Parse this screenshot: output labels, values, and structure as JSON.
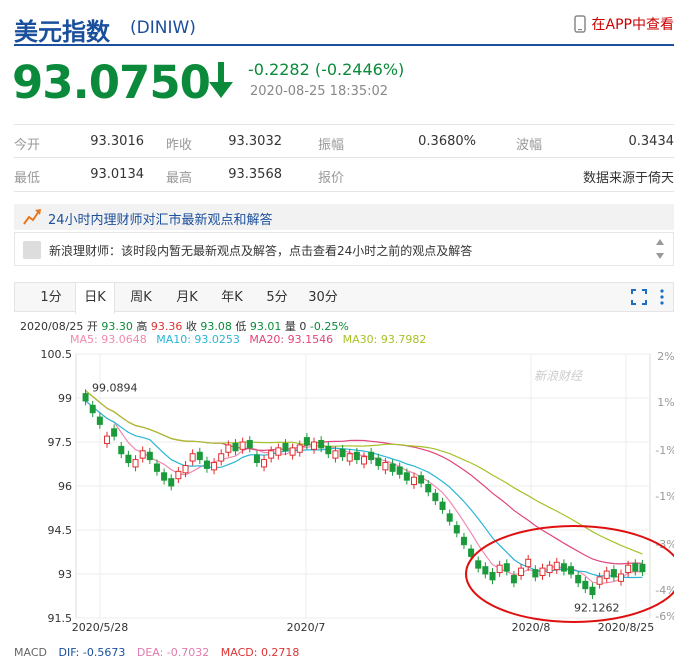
{
  "header": {
    "title": "美元指数",
    "code": "(DINIW)",
    "app_link": "在APP中查看"
  },
  "quote": {
    "price": "93.0750",
    "change": "-0.2282 (-0.2446%)",
    "time": "2020-08-25 18:35:02",
    "rows": [
      [
        {
          "label": "今开",
          "value": "93.3016"
        },
        {
          "label": "昨收",
          "value": "93.3032"
        },
        {
          "label": "振幅",
          "value": "0.3680%"
        },
        {
          "label": "波幅",
          "value": "0.3434"
        }
      ],
      [
        {
          "label": "最低",
          "value": "93.0134"
        },
        {
          "label": "最高",
          "value": "93.3568"
        },
        {
          "label": "报价",
          "value": ""
        },
        {
          "label": "",
          "value": "数据来源于倚天"
        }
      ]
    ]
  },
  "experts": {
    "headline": "24小时内理财师对汇市最新观点和解答",
    "message": "新浪理财师：该时段内暂无最新观点及解答，点击查看24小时之前的观点及解答"
  },
  "tabs": [
    "1分",
    "日K",
    "周K",
    "月K",
    "年K",
    "5分",
    "30分"
  ],
  "active_tab": "日K",
  "info": {
    "date": "2020/08/25",
    "kai_label": "开",
    "kai": "93.30",
    "gao_label": "高",
    "gao": "93.36",
    "shou_label": "收",
    "shou": "93.08",
    "di_label": "低",
    "di": "93.01",
    "liang_label": "量",
    "liang": "0",
    "pct": "-0.25%"
  },
  "ma": {
    "ma5": "MA5: 93.0648",
    "ma10": "MA10: 93.0253",
    "ma20": "MA20: 93.1546",
    "ma30": "MA30: 93.7982",
    "color_ma5": "#f08ab0",
    "color_ma10": "#29b6d6",
    "color_ma20": "#e0457b",
    "color_ma30": "#a6c229"
  },
  "macd": {
    "label": "MACD",
    "dif": "DIF: -0.5673",
    "dea": "DEA: -0.7032",
    "macd": "MACD: 0.2718",
    "color_dif": "#1a4f9c",
    "color_dea": "#e07ab0",
    "color_macd": "#d33"
  },
  "watermark": "新浪财经",
  "chart_data": {
    "type": "candlestick",
    "y_ticks": [
      "100.5",
      "99",
      "97.5",
      "96",
      "94.5",
      "93",
      "91.5"
    ],
    "y_ticks_pct": [
      "2%",
      "1%",
      "-1%",
      "-1%",
      "-3%",
      "-4%",
      "-6%",
      "-7%"
    ],
    "x_labels": [
      "2020/5/28",
      "2020/7",
      "2020/8",
      "2020/8/25"
    ],
    "ylim": [
      91.5,
      100.5
    ],
    "annotations": [
      {
        "text": "99.0894",
        "value": 99.0894
      },
      {
        "text": "92.1262",
        "value": 92.1262
      }
    ],
    "closes": [
      98.9,
      98.5,
      98.1,
      97.7,
      97.7,
      97.1,
      96.8,
      96.9,
      97.2,
      96.9,
      96.5,
      96.2,
      96.0,
      96.5,
      96.7,
      97.1,
      96.9,
      96.6,
      96.8,
      97.1,
      97.4,
      97.2,
      97.5,
      97.3,
      96.8,
      96.9,
      97.2,
      97.3,
      97.2,
      97.3,
      97.4,
      97.4,
      97.5,
      97.3,
      97.1,
      97.2,
      97.0,
      97.1,
      96.9,
      97.0,
      96.9,
      96.7,
      96.8,
      96.5,
      96.4,
      96.2,
      96.3,
      96.1,
      95.8,
      95.5,
      95.2,
      94.8,
      94.4,
      94.0,
      93.6,
      93.2,
      93.0,
      92.8,
      93.3,
      93.1,
      92.7,
      93.2,
      93.5,
      92.9,
      93.2,
      93.3,
      93.4,
      93.1,
      93.0,
      92.7,
      92.5,
      92.3,
      92.9,
      93.1,
      92.9,
      93.0,
      93.3,
      93.1,
      93.08
    ],
    "candle_up": [
      false,
      false,
      false,
      true,
      false,
      false,
      false,
      true,
      true,
      false,
      false,
      false,
      false,
      true,
      true,
      true,
      false,
      false,
      true,
      true,
      true,
      false,
      true,
      false,
      false,
      true,
      true,
      true,
      false,
      true,
      true,
      false,
      true,
      false,
      false,
      true,
      false,
      true,
      false,
      true,
      false,
      false,
      true,
      false,
      false,
      false,
      true,
      false,
      false,
      false,
      false,
      false,
      false,
      false,
      false,
      false,
      false,
      false,
      true,
      false,
      false,
      true,
      true,
      false,
      true,
      true,
      true,
      false,
      false,
      false,
      false,
      false,
      true,
      true,
      false,
      true,
      true,
      false,
      false
    ]
  }
}
